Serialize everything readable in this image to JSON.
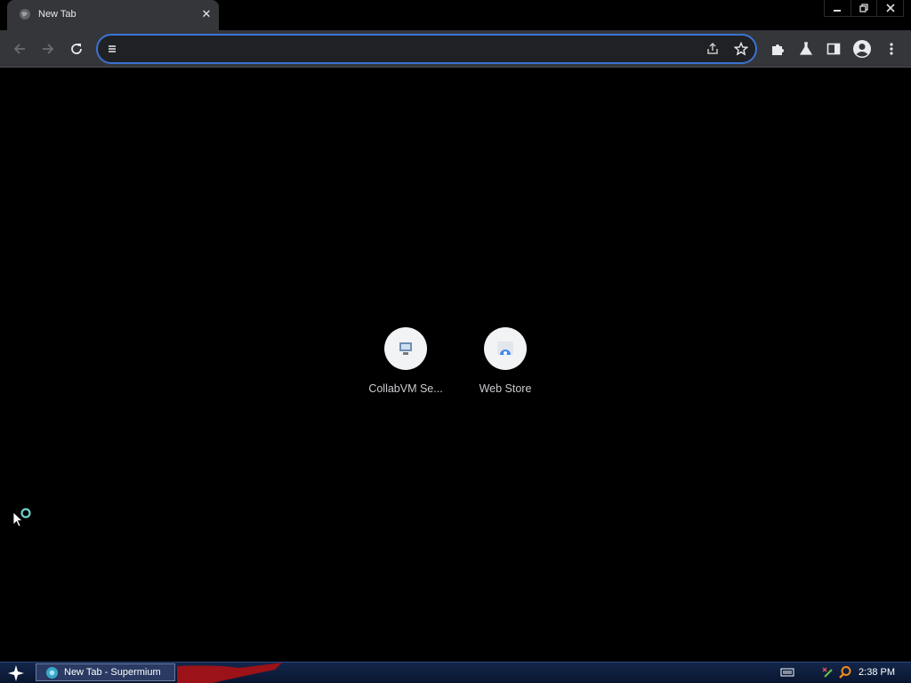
{
  "window": {
    "tab_title": "New Tab",
    "minimize_label": "–",
    "restore_label": "❐",
    "close_label": "✕"
  },
  "toolbar": {
    "address_value": "",
    "icons": [
      "back-icon",
      "forward-icon",
      "reload-icon",
      "share-icon",
      "bookmark-star-icon",
      "extensions-icon",
      "labs-icon",
      "side-panel-icon",
      "profile-icon",
      "menu-icon"
    ]
  },
  "shortcuts": [
    {
      "label": "CollabVM Se...",
      "icon": "collabvm-icon"
    },
    {
      "label": "Web Store",
      "icon": "web-store-icon"
    }
  ],
  "taskbar": {
    "task_label": "New Tab - Supermium",
    "clock": "2:38 PM"
  },
  "colors": {
    "accent": "#3b74d4",
    "toolbar": "#35363a",
    "background": "#000000"
  }
}
